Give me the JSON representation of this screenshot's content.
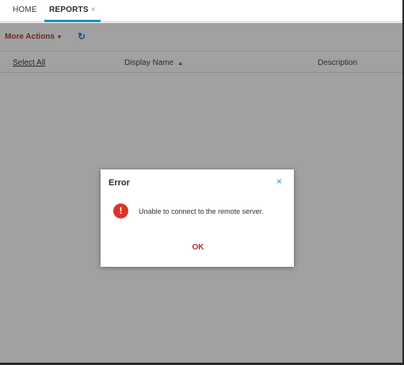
{
  "tabs": {
    "home_label": "HOME",
    "reports_label": "REPORTS",
    "reports_close": "×"
  },
  "toolbar": {
    "more_actions_label": "More Actions",
    "more_actions_caret": "▾",
    "refresh_icon": "refresh-icon",
    "refresh_glyph": "↻"
  },
  "grid": {
    "columns": [
      "Select All",
      "Display Name",
      "Description"
    ],
    "sort_glyph": "▲"
  },
  "dialog": {
    "title": "Error",
    "close_glyph": "×",
    "icon_glyph": "!",
    "message": "Unable to connect to the remote server.",
    "ok_label": "OK"
  },
  "colors": {
    "accent": "#1f8fc4",
    "action": "#a8342a",
    "error": "#d9342b"
  }
}
